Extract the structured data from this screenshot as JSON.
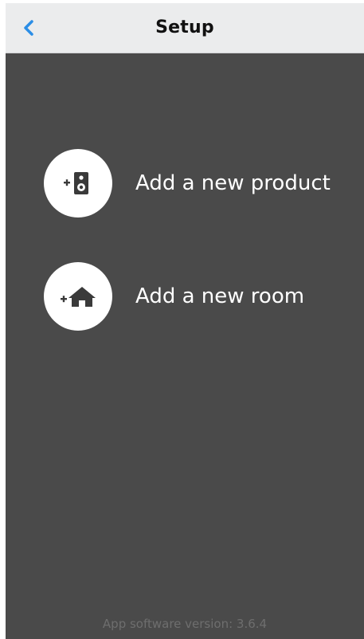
{
  "navbar": {
    "title": "Setup",
    "back_icon": "chevron-left-icon",
    "accent_color": "#2b8ee6"
  },
  "actions": [
    {
      "label": "Add a new product",
      "icon": "add-speaker-icon"
    },
    {
      "label": "Add a new room",
      "icon": "add-home-icon"
    }
  ],
  "footer": {
    "version_text": "App software version: 3.6.4"
  },
  "colors": {
    "background": "#4a4a4a",
    "navbar": "#ebeced",
    "circle": "#ffffff",
    "icon": "#3a3a3a"
  }
}
